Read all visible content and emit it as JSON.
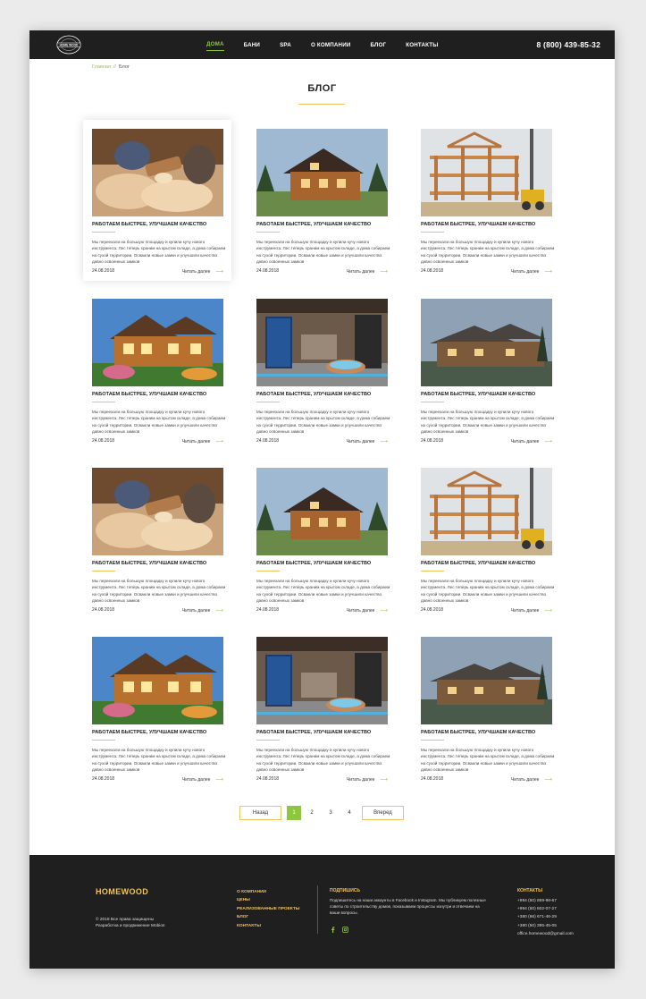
{
  "header": {
    "logo_text": "HOME WOOD",
    "nav": [
      "ДОМА",
      "БАНИ",
      "SPA",
      "О КОМПАНИИ",
      "БЛОГ",
      "КОНТАКТЫ"
    ],
    "phone": "8 (800) 439-85-32"
  },
  "breadcrumb": {
    "home": "Главная",
    "separator": "//",
    "current": "Блог"
  },
  "page_title": "БЛОГ",
  "posts": [
    {
      "title": "РАБОТАЕМ БЫСТРЕЕ, УЛУЧШАЕМ КАЧЕСТВО",
      "text": "Мы переехали на большую площадку и купили кучу нового инструмента. Лес теперь храним на крытом складе, а дома собираем на сухой территории. Осваили новые замки и улучшили качество давно освоенных замков",
      "date": "24.08.2018",
      "more": "Читать далее"
    },
    {
      "title": "РАБОТАЕМ БЫСТРЕЕ, УЛУЧШАЕМ КАЧЕСТВО",
      "text": "Мы переехали на большую площадку и купили кучу нового инструмента. Лес теперь храним на крытом складе, а дома собираем на сухой территории. Осваили новые замки и улучшили качество давно освоенных замков",
      "date": "24.08.2018",
      "more": "Читать далее"
    },
    {
      "title": "РАБОТАЕМ БЫСТРЕЕ, УЛУЧШАЕМ КАЧЕСТВО",
      "text": "Мы переехали на большую площадку и купили кучу нового инструмента. Лес теперь храним на крытом складе, а дома собираем на сухой территории. Осваили новые замки и улучшили качество давно освоенных замков",
      "date": "24.08.2018",
      "more": "Читать далее"
    },
    {
      "title": "РАБОТАЕМ БЫСТРЕЕ, УЛУЧШАЕМ КАЧЕСТВО",
      "text": "Мы переехали на большую площадку и купили кучу нового инструмента. Лес теперь храним на крытом складе, а дома собираем на сухой территории. Осваили новые замки и улучшили качество давно освоенных замков",
      "date": "24.08.2018",
      "more": "Читать далее"
    },
    {
      "title": "РАБОТАЕМ БЫСТРЕЕ, УЛУЧШАЕМ КАЧЕСТВО",
      "text": "Мы переехали на большую площадку и купили кучу нового инструмента. Лес теперь храним на крытом складе, а дома собираем на сухой территории. Осваили новые замки и улучшили качество давно освоенных замков",
      "date": "24.08.2018",
      "more": "Читать далее"
    },
    {
      "title": "РАБОТАЕМ БЫСТРЕЕ, УЛУЧШАЕМ КАЧЕСТВО",
      "text": "Мы переехали на большую площадку и купили кучу нового инструмента. Лес теперь храним на крытом складе, а дома собираем на сухой территории. Осваили новые замки и улучшили качество давно освоенных замков",
      "date": "24.08.2018",
      "more": "Читать далее"
    },
    {
      "title": "РАБОТАЕМ БЫСТРЕЕ, УЛУЧШАЕМ КАЧЕСТВО",
      "text": "Мы переехали на большую площадку и купили кучу нового инструмента. Лес теперь храним на крытом складе, а дома собираем на сухой территории. Осваили новые замки и улучшили качество давно освоенных замков",
      "date": "24.08.2018",
      "more": "Читать далее"
    },
    {
      "title": "РАБОТАЕМ БЫСТРЕЕ, УЛУЧШАЕМ КАЧЕСТВО",
      "text": "Мы переехали на большую площадку и купили кучу нового инструмента. Лес теперь храним на крытом складе, а дома собираем на сухой территории. Осваили новые замки и улучшили качество давно освоенных замков",
      "date": "24.08.2018",
      "more": "Читать далее"
    },
    {
      "title": "РАБОТАЕМ БЫСТРЕЕ, УЛУЧШАЕМ КАЧЕСТВО",
      "text": "Мы переехали на большую площадку и купили кучу нового инструмента. Лес теперь храним на крытом складе, а дома собираем на сухой территории. Осваили новые замки и улучшили качество давно освоенных замков",
      "date": "24.08.2018",
      "more": "Читать далее"
    },
    {
      "title": "РАБОТАЕМ БЫСТРЕЕ, УЛУЧШАЕМ КАЧЕСТВО",
      "text": "Мы переехали на большую площадку и купили кучу нового инструмента. Лес теперь храним на крытом складе, а дома собираем на сухой территории. Осваили новые замки и улучшили качество давно освоенных замков",
      "date": "24.08.2018",
      "more": "Читать далее"
    },
    {
      "title": "РАБОТАЕМ БЫСТРЕЕ, УЛУЧШАЕМ КАЧЕСТВО",
      "text": "Мы переехали на большую площадку и купили кучу нового инструмента. Лес теперь храним на крытом складе, а дома собираем на сухой территории. Осваили новые замки и улучшили качество давно освоенных замков",
      "date": "24.08.2018",
      "more": "Читать далее"
    },
    {
      "title": "РАБОТАЕМ БЫСТРЕЕ, УЛУЧШАЕМ КАЧЕСТВО",
      "text": "Мы переехали на большую площадку и купили кучу нового инструмента. Лес теперь храним на крытом складе, а дома собираем на сухой территории. Осваили новые замки и улучшили качество давно освоенных замков",
      "date": "24.08.2018",
      "more": "Читать далее"
    }
  ],
  "pagination": {
    "prev": "Назад",
    "pages": [
      "1",
      "2",
      "3",
      "4"
    ],
    "current": "1",
    "next": "Вперед"
  },
  "footer": {
    "brand": "HOMEWOOD",
    "copyright": "© 2018 Все права защищены",
    "developer": "Разработка и продвижение Mobios",
    "menu": [
      "О КОМПАНИИ",
      "ЦЕНЫ",
      "РЕАЛИЗОВАННЫЕ ПРОЕКТЫ",
      "БЛОГ",
      "КОНТАКТЫ"
    ],
    "subscribe_title": "ПОДПИШИСЬ",
    "subscribe_text": "Подпишитесь на наши аккаунты в Facebook и Instagram. Мы публикуем полезные советы по строительству домов, показываем процессы изнутри и отвечаем на ваши вопросы.",
    "contacts_title": "КОНТАКТЫ",
    "phones": [
      "+994 (50) 859-98-67",
      "+994 (50) 602-07-27",
      "+380 (66) 671-46-29",
      "+380 (50) 395-45-05"
    ],
    "email": "office.homewood@gmail.com"
  },
  "colors": {
    "accent_green": "#8dc63f",
    "accent_gold": "#f0c35a",
    "dark": "#1f1f1f"
  },
  "icons": {
    "facebook": "facebook-icon",
    "instagram": "instagram-icon",
    "arrow": "arrow-right-icon"
  }
}
